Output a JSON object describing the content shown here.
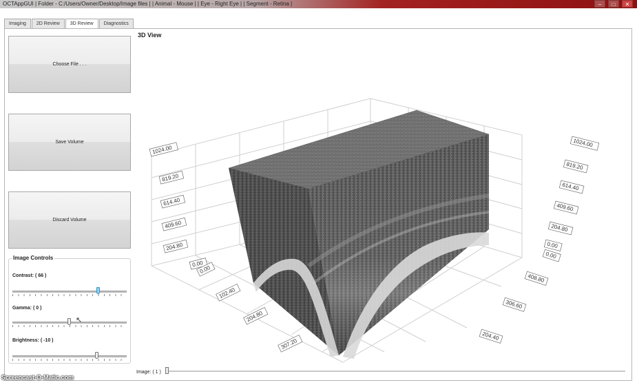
{
  "window": {
    "title": "OCTAppGUI | Folder - C:/Users/Owner/Desktop/Image files | | Animal - Mouse | | Eye - Right Eye | | Segment - Retina |",
    "minimize": "–",
    "maximize": "□",
    "close": "✕"
  },
  "tabs": [
    {
      "label": "Imaging",
      "active": false
    },
    {
      "label": "2D Review",
      "active": false
    },
    {
      "label": "3D Review",
      "active": true
    },
    {
      "label": "Diagnostics",
      "active": false
    }
  ],
  "buttons": {
    "choose_file": "Choose File . . .",
    "save_volume": "Save Volume",
    "discard_volume": "Discard Volume"
  },
  "image_controls": {
    "title": "Image Controls",
    "contrast": {
      "label": "Contrast: ( 66 )",
      "value": 66
    },
    "gamma": {
      "label": "Gamma: ( 0 )",
      "value": 0
    },
    "brightness": {
      "label": "Brightness: ( -10 )",
      "value": -10
    }
  },
  "view": {
    "title": "3D View",
    "left_axis": [
      "1024.00",
      "819.20",
      "614.40",
      "409.60",
      "204.80",
      "0.00"
    ],
    "right_axis": [
      "1024.00",
      "819.20",
      "614.40",
      "409.60",
      "204.80",
      "0.00"
    ],
    "front_axis": [
      "0.00",
      "102.40",
      "204.80",
      "307.20"
    ],
    "right_floor_axis": [
      "0.00",
      "408.80",
      "306.60",
      "204.40"
    ]
  },
  "image_slider": {
    "label": "Image: ( 1 )",
    "value": 1
  },
  "watermark": "Screencast-O-Matic.com",
  "icons": {
    "cursor": "arrow-cursor-icon"
  }
}
